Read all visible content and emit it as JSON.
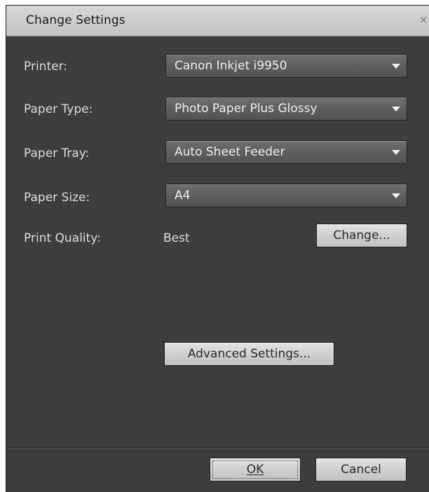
{
  "window": {
    "title": "Change Settings",
    "close_glyph": "×"
  },
  "fields": {
    "printer": {
      "label": "Printer:",
      "value": "Canon Inkjet i9950"
    },
    "paper_type": {
      "label": "Paper Type:",
      "value": "Photo Paper Plus Glossy"
    },
    "paper_tray": {
      "label": "Paper Tray:",
      "value": "Auto Sheet Feeder"
    },
    "paper_size": {
      "label": "Paper Size:",
      "value": "A4"
    },
    "print_quality": {
      "label": "Print Quality:",
      "value": "Best"
    }
  },
  "buttons": {
    "change": "Change...",
    "advanced": "Advanced Settings...",
    "ok": "OK",
    "cancel": "Cancel"
  },
  "icons": {
    "dropdown_arrow": "chevron-down-icon",
    "close": "close-icon"
  },
  "colors": {
    "panel_bg": "#3d3d3d",
    "titlebar_bg": "#c8c8c8",
    "label_text": "#dcdcdc",
    "select_bg": "#5e5e5e",
    "button_bg": "#d0d0d0"
  }
}
